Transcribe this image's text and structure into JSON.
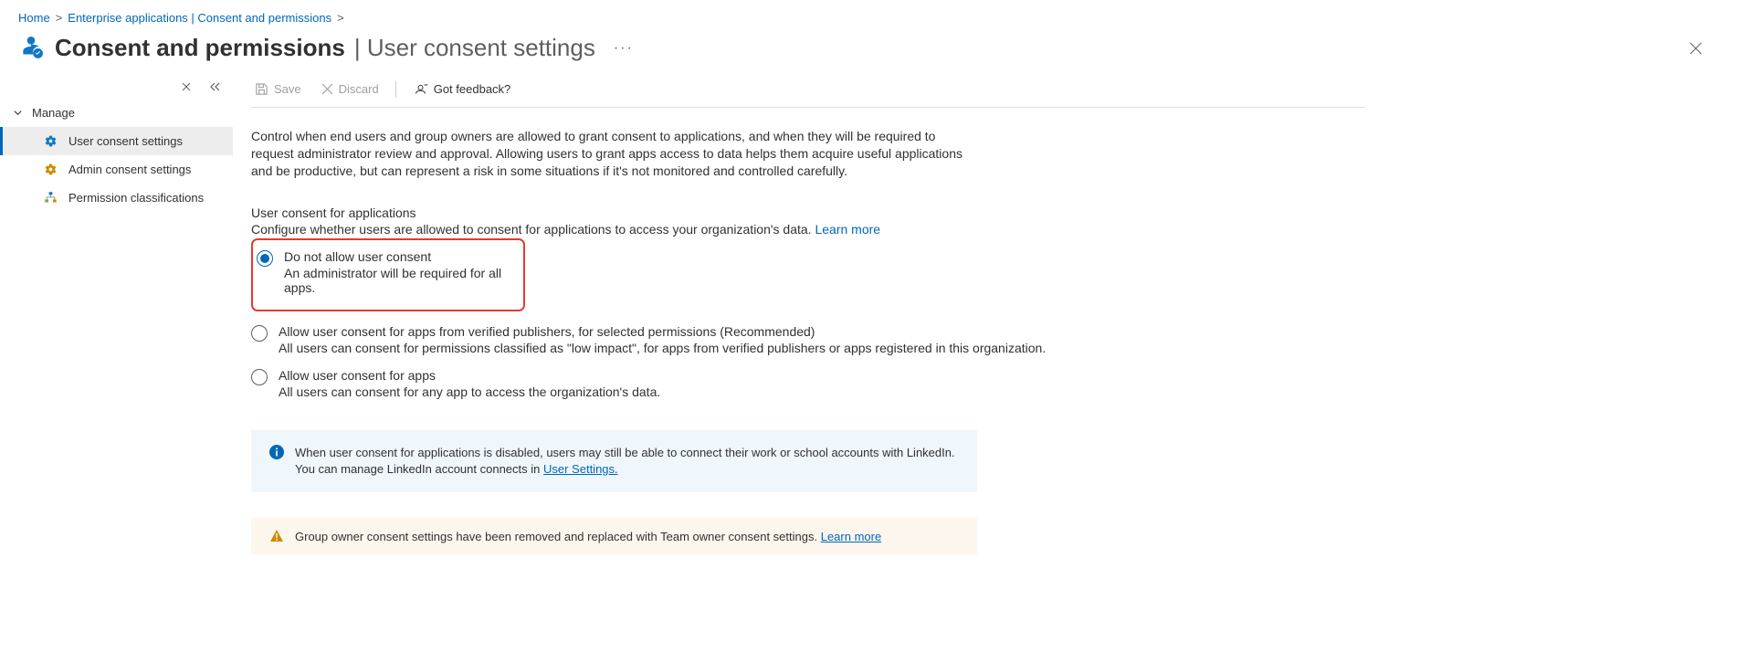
{
  "breadcrumb": {
    "home": "Home",
    "item1": "Enterprise applications | Consent and permissions"
  },
  "header": {
    "title": "Consent and permissions",
    "subtitle": "User consent settings"
  },
  "sidebar": {
    "section": "Manage",
    "items": [
      {
        "label": "User consent settings",
        "active": true
      },
      {
        "label": "Admin consent settings",
        "active": false
      },
      {
        "label": "Permission classifications",
        "active": false
      }
    ]
  },
  "toolbar": {
    "save": "Save",
    "discard": "Discard",
    "feedback": "Got feedback?"
  },
  "main": {
    "intro": "Control when end users and group owners are allowed to grant consent to applications, and when they will be required to request administrator review and approval. Allowing users to grant apps access to data helps them acquire useful applications and be productive, but can represent a risk in some situations if it's not monitored and controlled carefully.",
    "section_heading": "User consent for applications",
    "section_sub": "Configure whether users are allowed to consent for applications to access your organization's data.",
    "learn_more": "Learn more",
    "options": [
      {
        "label": "Do not allow user consent",
        "desc": "An administrator will be required for all apps.",
        "checked": true
      },
      {
        "label": "Allow user consent for apps from verified publishers, for selected permissions (Recommended)",
        "desc": "All users can consent for permissions classified as \"low impact\", for apps from verified publishers or apps registered in this organization.",
        "checked": false
      },
      {
        "label": "Allow user consent for apps",
        "desc": "All users can consent for any app to access the organization's data.",
        "checked": false
      }
    ],
    "info_callout_pre": "When user consent for applications is disabled, users may still be able to connect their work or school accounts with LinkedIn. You can manage LinkedIn account connects in ",
    "info_callout_link": "User Settings.",
    "warn_callout_pre": "Group owner consent settings have been removed and replaced with Team owner consent settings. ",
    "warn_callout_link": "Learn more"
  }
}
